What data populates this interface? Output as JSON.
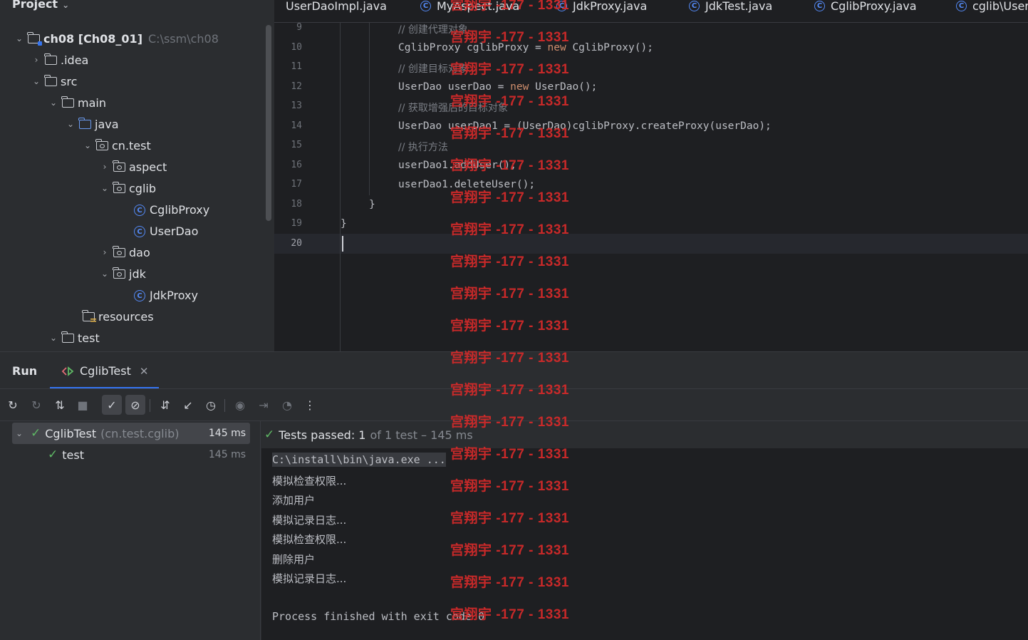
{
  "project": {
    "title": "Project",
    "tree": [
      {
        "label": "ch08 [Ch08_01]",
        "extra": "C:\\ssm\\ch08"
      },
      {
        "label": ".idea"
      },
      {
        "label": "src"
      },
      {
        "label": "main"
      },
      {
        "label": "java"
      },
      {
        "label": "cn.test"
      },
      {
        "label": "aspect"
      },
      {
        "label": "cglib"
      },
      {
        "label": "CglibProxy"
      },
      {
        "label": "UserDao"
      },
      {
        "label": "dao"
      },
      {
        "label": "jdk"
      },
      {
        "label": "JdkProxy"
      },
      {
        "label": "resources"
      },
      {
        "label": "test"
      }
    ]
  },
  "editor": {
    "tabs": [
      "UserDaoImpl.java",
      "MyAspect.java",
      "JdkProxy.java",
      "JdkTest.java",
      "CglibProxy.java",
      "cglib\\UserDao.java"
    ],
    "line_numbers": [
      "9",
      "10",
      "11",
      "12",
      "13",
      "14",
      "15",
      "16",
      "17",
      "18",
      "19",
      "20"
    ],
    "code": {
      "l9_comment": "// 创建代理对象",
      "l10_a": "CglibProxy cglibProxy = ",
      "l10_kw": "new",
      "l10_b": " CglibProxy();",
      "l11_comment": "// 创建目标对象",
      "l12_a": "UserDao userDao = ",
      "l12_kw": "new",
      "l12_b": " UserDao();",
      "l13_comment": "// 获取增强后的目标对象",
      "l14": "UserDao userDao1 = (UserDao)cglibProxy.createProxy(userDao);",
      "l15_comment": "// 执行方法",
      "l16": "userDao1.addUser();",
      "l17": "userDao1.deleteUser();",
      "l18": "}",
      "l19": "}"
    }
  },
  "run": {
    "title": "Run",
    "tab_label": "CglibTest",
    "tests": {
      "suite_name": "CglibTest",
      "suite_pkg": "(cn.test.cglib)",
      "suite_time": "145 ms",
      "test_name": "test",
      "test_time": "145 ms"
    },
    "status": {
      "passed": "Tests passed: 1",
      "detail": "of 1 test – 145 ms"
    },
    "console": [
      "C:\\install\\bin\\java.exe ...",
      "模拟检查权限...",
      "添加用户",
      "模拟记录日志...",
      "模拟检查权限...",
      "删除用户",
      "模拟记录日志...",
      "Process finished with exit code 0"
    ]
  },
  "watermark": {
    "text": "宫翔宇 -177 - 1331",
    "color": "#d42a2a"
  },
  "colors": {
    "accent": "#3574f0",
    "pass": "#5fb865",
    "keyword": "#cf8e6d"
  }
}
